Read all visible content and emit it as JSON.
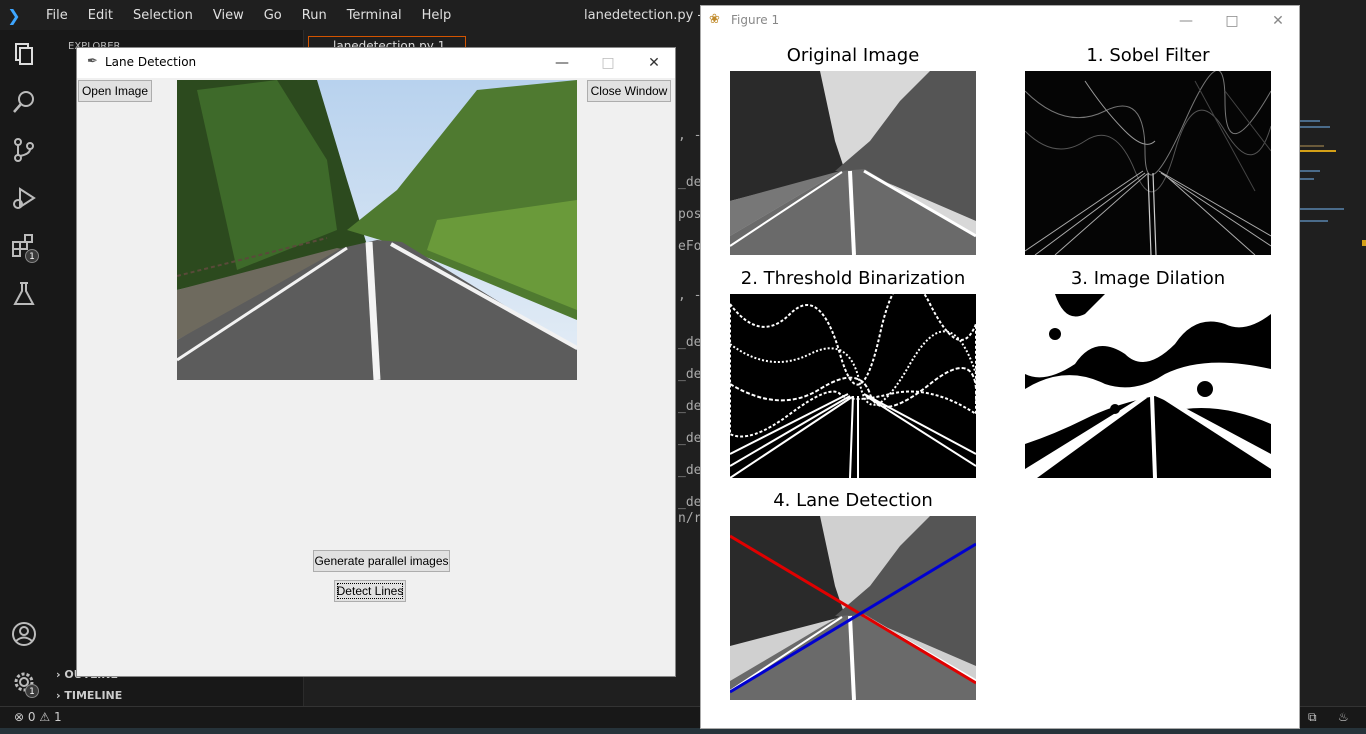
{
  "vscode": {
    "menu": [
      "File",
      "Edit",
      "Selection",
      "View",
      "Go",
      "Run",
      "Terminal",
      "Help"
    ],
    "window_title": "lanedetection.py - Visi",
    "explorer_label": "EXPLORER",
    "tab_label": "lanedetection.py 1",
    "outline_label": "OUTLINE",
    "timeline_label": "TIMELINE",
    "status_errors": "0",
    "status_warnings": "1",
    "extensions_badge": "1",
    "settings_badge": "1",
    "code_fragments": [
      ", -",
      "_det",
      "posi",
      "eFor",
      ", -",
      "_det",
      "_det",
      "_det",
      "_det",
      "_det",
      "_det",
      "n/r"
    ]
  },
  "lane_window": {
    "title": "Lane Detection",
    "open_label": "Open Image",
    "close_label": "Close Window",
    "generate_label": "Generate parallel images",
    "detect_label": "Detect Lines"
  },
  "figure_window": {
    "title": "Figure 1",
    "panels": {
      "original": "Original Image",
      "sobel": "1. Sobel Filter",
      "threshold": "2. Threshold Binarization",
      "dilation": "3. Image Dilation",
      "lane": "4. Lane Detection"
    }
  },
  "colors": {
    "accent": "#3ea6ff",
    "tab_border": "#d35400",
    "left_lane_line": "#e00000",
    "right_lane_line": "#0000d0"
  }
}
